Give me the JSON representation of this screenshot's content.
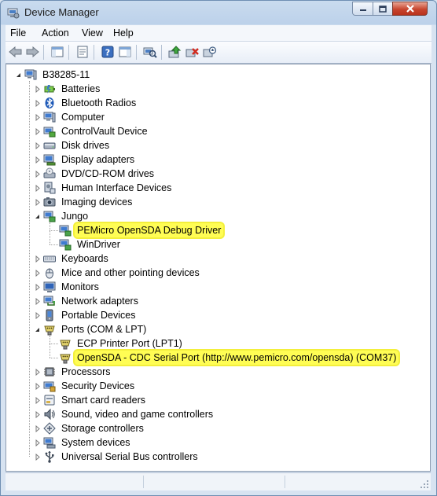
{
  "window": {
    "title": "Device Manager"
  },
  "menu": {
    "items": [
      "File",
      "Action",
      "View",
      "Help"
    ]
  },
  "toolbar": {
    "buttons": [
      {
        "name": "back-arrow-icon"
      },
      {
        "name": "forward-arrow-icon"
      },
      {
        "name": "show-hide-console-tree-icon"
      },
      {
        "name": "properties-icon"
      },
      {
        "name": "help-icon"
      },
      {
        "name": "show-hide-action-pane-icon"
      },
      {
        "name": "scan-hardware-icon"
      },
      {
        "name": "update-driver-icon"
      },
      {
        "name": "uninstall-icon"
      },
      {
        "name": "disable-device-icon"
      }
    ]
  },
  "tree": {
    "root": "B38285-11",
    "items": [
      {
        "label": "Batteries",
        "icon": "battery-icon",
        "expanded": false,
        "children": []
      },
      {
        "label": "Bluetooth Radios",
        "icon": "bluetooth-icon",
        "expanded": false,
        "children": []
      },
      {
        "label": "Computer",
        "icon": "computer-icon",
        "expanded": false,
        "children": []
      },
      {
        "label": "ControlVault Device",
        "icon": "controlvault-icon",
        "expanded": false,
        "children": []
      },
      {
        "label": "Disk drives",
        "icon": "disk-drive-icon",
        "expanded": false,
        "children": []
      },
      {
        "label": "Display adapters",
        "icon": "display-adapter-icon",
        "expanded": false,
        "children": []
      },
      {
        "label": "DVD/CD-ROM drives",
        "icon": "dvd-drive-icon",
        "expanded": false,
        "children": []
      },
      {
        "label": "Human Interface Devices",
        "icon": "hid-icon",
        "expanded": false,
        "children": []
      },
      {
        "label": "Imaging devices",
        "icon": "camera-icon",
        "expanded": false,
        "children": []
      },
      {
        "label": "Jungo",
        "icon": "jungo-icon",
        "expanded": true,
        "children": [
          {
            "label": "PEMicro OpenSDA Debug Driver",
            "icon": "usb-device-icon",
            "highlighted": true
          },
          {
            "label": "WinDriver",
            "icon": "usb-device-icon",
            "highlighted": false
          }
        ]
      },
      {
        "label": "Keyboards",
        "icon": "keyboard-icon",
        "expanded": false,
        "children": []
      },
      {
        "label": "Mice and other pointing devices",
        "icon": "mouse-icon",
        "expanded": false,
        "children": []
      },
      {
        "label": "Monitors",
        "icon": "monitor-icon",
        "expanded": false,
        "children": []
      },
      {
        "label": "Network adapters",
        "icon": "network-adapter-icon",
        "expanded": false,
        "children": []
      },
      {
        "label": "Portable Devices",
        "icon": "portable-device-icon",
        "expanded": false,
        "children": []
      },
      {
        "label": "Ports (COM & LPT)",
        "icon": "port-icon",
        "expanded": true,
        "children": [
          {
            "label": "ECP Printer Port (LPT1)",
            "icon": "port-icon",
            "highlighted": false
          },
          {
            "label": "OpenSDA - CDC Serial Port (http://www.pemicro.com/opensda) (COM37)",
            "icon": "port-icon",
            "highlighted": true
          }
        ]
      },
      {
        "label": "Processors",
        "icon": "processor-icon",
        "expanded": false,
        "children": []
      },
      {
        "label": "Security Devices",
        "icon": "security-device-icon",
        "expanded": false,
        "children": []
      },
      {
        "label": "Smart card readers",
        "icon": "smart-card-reader-icon",
        "expanded": false,
        "children": []
      },
      {
        "label": "Sound, video and game controllers",
        "icon": "sound-icon",
        "expanded": false,
        "children": []
      },
      {
        "label": "Storage controllers",
        "icon": "storage-controller-icon",
        "expanded": false,
        "children": []
      },
      {
        "label": "System devices",
        "icon": "system-device-icon",
        "expanded": false,
        "children": []
      },
      {
        "label": "Universal Serial Bus controllers",
        "icon": "usb-controller-icon",
        "expanded": false,
        "children": []
      }
    ]
  },
  "colors": {
    "highlight": "#fffd54",
    "title_bar": "#c9dbee",
    "close_button": "#c8462f"
  }
}
